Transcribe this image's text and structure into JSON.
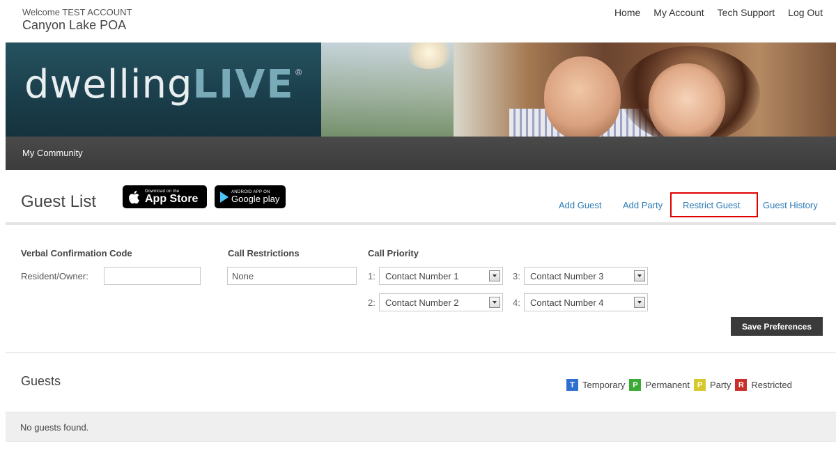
{
  "header": {
    "welcome": "Welcome TEST ACCOUNT",
    "community": "Canyon Lake POA",
    "nav": [
      "Home",
      "My Account",
      "Tech Support",
      "Log Out"
    ]
  },
  "banner": {
    "logo_main": "dwelling",
    "logo_accent": "LIVE",
    "logo_mark": "®"
  },
  "community_bar": {
    "item": "My Community"
  },
  "guest_list": {
    "title": "Guest List",
    "app_store": {
      "small": "Download on the",
      "big": "App Store",
      "icon": "apple-icon"
    },
    "google_play": {
      "small": "ANDROID APP ON",
      "big": "Google play",
      "icon": "play-icon"
    },
    "links": [
      "Add Guest",
      "Add Party",
      "Restrict Guest",
      "Guest History"
    ],
    "highlight_color": "#e00000"
  },
  "preferences": {
    "verbal_heading": "Verbal Confirmation Code",
    "resident_label": "Resident/Owner:",
    "resident_value": "",
    "restrictions_heading": "Call Restrictions",
    "restrictions_value": "None",
    "priority_heading": "Call Priority",
    "priorities": [
      {
        "num": "1:",
        "value": "Contact Number 1"
      },
      {
        "num": "2:",
        "value": "Contact Number 2"
      },
      {
        "num": "3:",
        "value": "Contact Number 3"
      },
      {
        "num": "4:",
        "value": "Contact Number 4"
      }
    ],
    "save_label": "Save Preferences"
  },
  "guests": {
    "title": "Guests",
    "legend": [
      {
        "letter": "T",
        "label": "Temporary",
        "color": "#2f6fd0"
      },
      {
        "letter": "P",
        "label": "Permanent",
        "color": "#3aaa35"
      },
      {
        "letter": "P",
        "label": "Party",
        "color": "#d8c92a"
      },
      {
        "letter": "R",
        "label": "Restricted",
        "color": "#c9302c"
      }
    ],
    "empty_message": "No guests found."
  }
}
